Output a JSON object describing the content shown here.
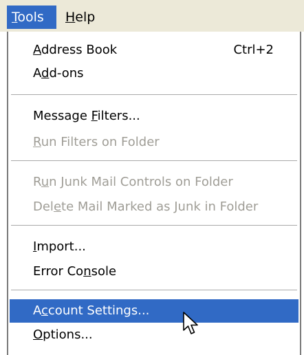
{
  "menubar": {
    "tools": {
      "pre": "",
      "accel": "T",
      "post": "ools"
    },
    "help": {
      "pre": "",
      "accel": "H",
      "post": "elp"
    }
  },
  "menu": {
    "address_book": {
      "pre": "",
      "accel": "A",
      "post": "ddress Book",
      "shortcut": "Ctrl+2"
    },
    "addons": {
      "pre": "A",
      "accel": "d",
      "post": "d-ons"
    },
    "message_filters": {
      "pre": "Message ",
      "accel": "F",
      "post": "ilters..."
    },
    "run_filters": {
      "pre": "",
      "accel": "R",
      "post": "un Filters on Folder"
    },
    "run_junk": {
      "pre": "R",
      "accel": "u",
      "post": "n Junk Mail Controls on Folder"
    },
    "delete_junk": {
      "pre": "Del",
      "accel": "e",
      "post": "te Mail Marked as Junk in Folder"
    },
    "import": {
      "pre": "",
      "accel": "I",
      "post": "mport..."
    },
    "error_console": {
      "pre": "Error Co",
      "accel": "n",
      "post": "sole"
    },
    "account_settings": {
      "pre": "A",
      "accel": "c",
      "post": "count Settings..."
    },
    "options": {
      "pre": "",
      "accel": "O",
      "post": "ptions..."
    }
  },
  "colors": {
    "highlight": "#316ac5",
    "menubar_bg": "#ece9d8",
    "disabled_text": "#9f9d96"
  },
  "cursor": {
    "icon": "arrow-cursor-icon"
  }
}
